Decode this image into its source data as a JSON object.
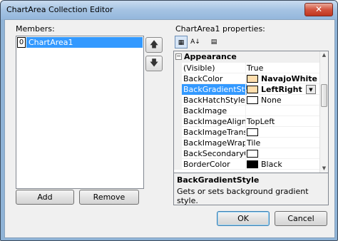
{
  "window": {
    "title": "ChartArea Collection Editor",
    "close_label": "✕"
  },
  "members": {
    "label": "Members:",
    "items": [
      {
        "index": "0",
        "name": "ChartArea1"
      }
    ],
    "add_label": "Add",
    "remove_label": "Remove",
    "move_up_glyph": "🡅",
    "move_down_glyph": "🡇"
  },
  "properties": {
    "label": "ChartArea1 properties:",
    "toolbar": [
      {
        "name": "categorized-icon",
        "glyph": "▦",
        "active": true
      },
      {
        "name": "alphabetical-icon",
        "glyph": "A↓",
        "active": false
      },
      {
        "name": "property-pages-icon",
        "glyph": "▤",
        "active": false
      }
    ],
    "category": {
      "sign": "−",
      "name": "Appearance"
    },
    "rows": [
      {
        "name": "(Visible)",
        "value": "True"
      },
      {
        "name": "BackColor",
        "value": "NavajoWhite",
        "swatch": "#ffdead",
        "bold": true
      },
      {
        "name": "BackGradientStyle",
        "value": "LeftRight",
        "swatch": "#ffdead",
        "bold": true,
        "selected": true
      },
      {
        "name": "BackHatchStyle",
        "value": "None",
        "swatch": "#ffffff"
      },
      {
        "name": "BackImage",
        "value": ""
      },
      {
        "name": "BackImageAlignme",
        "value": "TopLeft"
      },
      {
        "name": "BackImageTranspa",
        "value": "",
        "swatch": "#ffffff"
      },
      {
        "name": "BackImageWrapMc",
        "value": "Tile"
      },
      {
        "name": "BackSecondaryColo",
        "value": "",
        "swatch": "#ffffff"
      },
      {
        "name": "BorderColor",
        "value": "Black",
        "swatch": "#000000"
      }
    ],
    "description": {
      "title": "BackGradientStyle",
      "text": "Gets or sets background gradient style."
    }
  },
  "footer": {
    "ok_label": "OK",
    "cancel_label": "Cancel"
  }
}
